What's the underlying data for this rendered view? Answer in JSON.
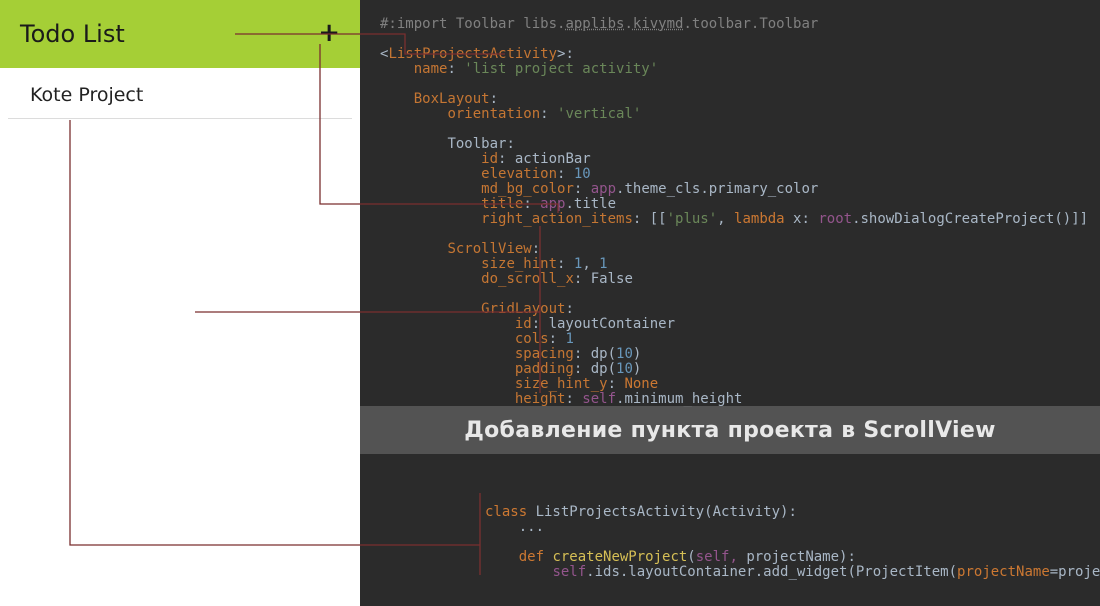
{
  "app": {
    "title": "Todo List",
    "plus": "+",
    "project_item": "Kote Project"
  },
  "banner": "Добавление пункта проекта в ScrollView",
  "code_top": {
    "l1_a": "#:import Toolbar libs.",
    "l1_b": "applibs",
    "l1_c": ".",
    "l1_d": "kivymd",
    "l1_e": ".toolbar.Toolbar",
    "l2_a": "<",
    "l2_b": "ListProjectsActivity",
    "l2_c": ">:",
    "l3_a": "name",
    "l3_b": ": ",
    "l3_c": "'list project activity'",
    "l4_a": "BoxLayout",
    "l4_b": ":",
    "l5_a": "orientation",
    "l5_b": ": ",
    "l5_c": "'vertical'",
    "l6_a": "Toolbar",
    "l6_b": ":",
    "l7_a": "id",
    "l7_b": ": actionBar",
    "l8_a": "elevation",
    "l8_b": ": ",
    "l8_c": "10",
    "l9_a": "md_bg_color",
    "l9_b": ": ",
    "l9_c": "app",
    "l9_d": ".theme_cls.primary_color",
    "l10_a": "title",
    "l10_b": ": ",
    "l10_c": "app",
    "l10_d": ".title",
    "l11_a": "right_action_items",
    "l11_b": ": [[",
    "l11_c": "'plus'",
    "l11_d": ", ",
    "l11_e": "lambda ",
    "l11_f": "x: ",
    "l11_g": "root",
    "l11_h": ".showDialogCreateProject()]]",
    "l12_a": "ScrollView",
    "l12_b": ":",
    "l13_a": "size_hint",
    "l13_b": ": ",
    "l13_c": "1",
    "l13_d": ", ",
    "l13_e": "1",
    "l14_a": "do_scroll_x",
    "l14_b": ": False",
    "l15_a": "GridLayout",
    "l15_b": ":",
    "l16_a": "id",
    "l16_b": ": layoutContainer",
    "l17_a": "cols",
    "l17_b": ": ",
    "l17_c": "1",
    "l18_a": "spacing",
    "l18_b": ": dp(",
    "l18_c": "10",
    "l18_d": ")",
    "l19_a": "padding",
    "l19_b": ": dp(",
    "l19_c": "10",
    "l19_d": ")",
    "l20_a": "size_hint_y",
    "l20_b": ": ",
    "l20_c": "None",
    "l21_a": "height",
    "l21_b": ": ",
    "l21_c": "self",
    "l21_d": ".minimum_height"
  },
  "code_bottom": {
    "l1_a": "class ",
    "l1_b": "ListProjectsActivity(Activity):",
    "l2": "    ...",
    "l3_a": "    def ",
    "l3_b": "createNewProject",
    "l3_c": "(",
    "l3_d": "self, ",
    "l3_e": "projectName):",
    "l4_a": "        ",
    "l4_b": "self",
    "l4_c": ".ids.layoutContainer.add_widget(ProjectItem(",
    "l4_d": "projectName",
    "l4_e": "=projectName))"
  }
}
